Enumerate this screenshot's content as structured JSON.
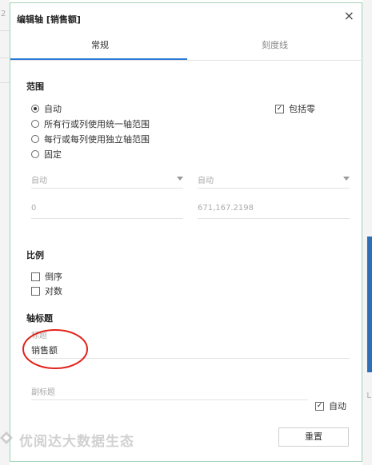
{
  "background": {
    "left_text": "2",
    "right_text": "L"
  },
  "dialog": {
    "title": "编辑轴 [销售额]",
    "close_glyph": "×",
    "tabs": [
      {
        "label": "常规",
        "active": true
      },
      {
        "label": "刻度线",
        "active": false
      }
    ],
    "range": {
      "title": "范围",
      "options": [
        {
          "label": "自动",
          "selected": true
        },
        {
          "label": "所有行或列使用统一轴范围",
          "selected": false
        },
        {
          "label": "每行或每列使用独立轴范围",
          "selected": false
        },
        {
          "label": "固定",
          "selected": false
        }
      ],
      "include_zero": {
        "label": "包括零",
        "checked": true
      },
      "start_select": "自动",
      "end_select": "自动",
      "start_value": "0",
      "end_value": "671,167.2198"
    },
    "scale": {
      "title": "比例",
      "options": [
        {
          "label": "倒序",
          "checked": false
        },
        {
          "label": "对数",
          "checked": false
        }
      ]
    },
    "axis_title": {
      "title": "轴标题",
      "title_field_label": "标题",
      "title_value": "销售额",
      "subtitle_placeholder": "副标题",
      "auto": {
        "label": "自动",
        "checked": true
      }
    },
    "reset_label": "重置"
  },
  "watermark": "优阅达大数据生态",
  "colors": {
    "accent": "#2b7bd6",
    "border": "#9fd2b4",
    "annotation": "#e2231a"
  }
}
